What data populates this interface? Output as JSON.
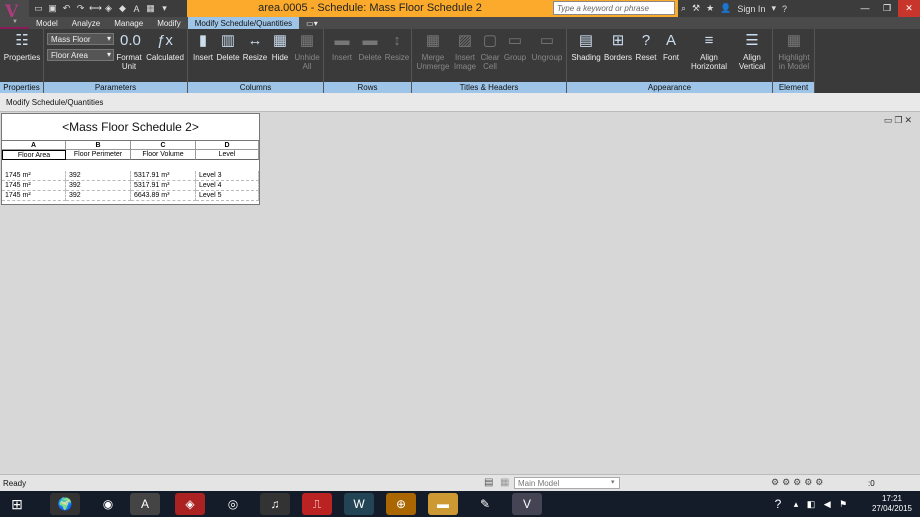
{
  "app": {
    "title": "area.0005 - Schedule: Mass Floor Schedule 2",
    "search_placeholder": "Type a keyword or phrase",
    "signin": "Sign In"
  },
  "tabs": [
    "Model",
    "Analyze",
    "Manage",
    "Modify",
    "Modify Schedule/Quantities"
  ],
  "ribbon": {
    "params_dd1": "Mass Floor",
    "params_dd2": "Floor Area",
    "panels": {
      "properties": "Properties",
      "parameters": "Parameters",
      "columns": "Columns",
      "rows": "Rows",
      "titles": "Titles & Headers",
      "appearance": "Appearance",
      "element": "Element"
    },
    "buttons": {
      "properties": "Properties",
      "format_unit": "Format Unit",
      "calculated": "Calculated",
      "insert": "Insert",
      "delete": "Delete",
      "resize": "Resize",
      "hide": "Hide",
      "unhide_all": "Unhide All",
      "row_insert": "Insert",
      "row_delete": "Delete",
      "row_resize": "Resize",
      "merge": "Merge Unmerge",
      "insert_image": "Insert Image",
      "clear_cell": "Clear Cell",
      "group": "Group",
      "ungroup": "Ungroup",
      "shading": "Shading",
      "borders": "Borders",
      "reset": "Reset",
      "font": "Font",
      "align_h": "Align Horizontal",
      "align_v": "Align Vertical",
      "highlight": "Highlight in Model"
    }
  },
  "context_label": "Modify Schedule/Quantities",
  "schedule": {
    "title": "<Mass Floor Schedule 2>",
    "letters": [
      "A",
      "B",
      "C",
      "D"
    ],
    "headers": [
      "Floor Area",
      "Floor Perimeter",
      "Floor Volume",
      "Level"
    ],
    "rows": [
      [
        "1745 m²",
        "392",
        "5317.91 m³",
        "Level 3"
      ],
      [
        "1745 m²",
        "392",
        "5317.91 m³",
        "Level 4"
      ],
      [
        "1745 m²",
        "392",
        "6643.89 m³",
        "Level 5"
      ]
    ]
  },
  "status": {
    "text": "Ready",
    "model": "Main Model",
    "filter_count": ":0"
  },
  "clock": {
    "time": "17:21",
    "date": "27/04/2015"
  },
  "colors": {
    "title_bar": "#fbaa2b",
    "ribbon": "#3a3a3a",
    "active_tab": "#9ec5e8"
  }
}
